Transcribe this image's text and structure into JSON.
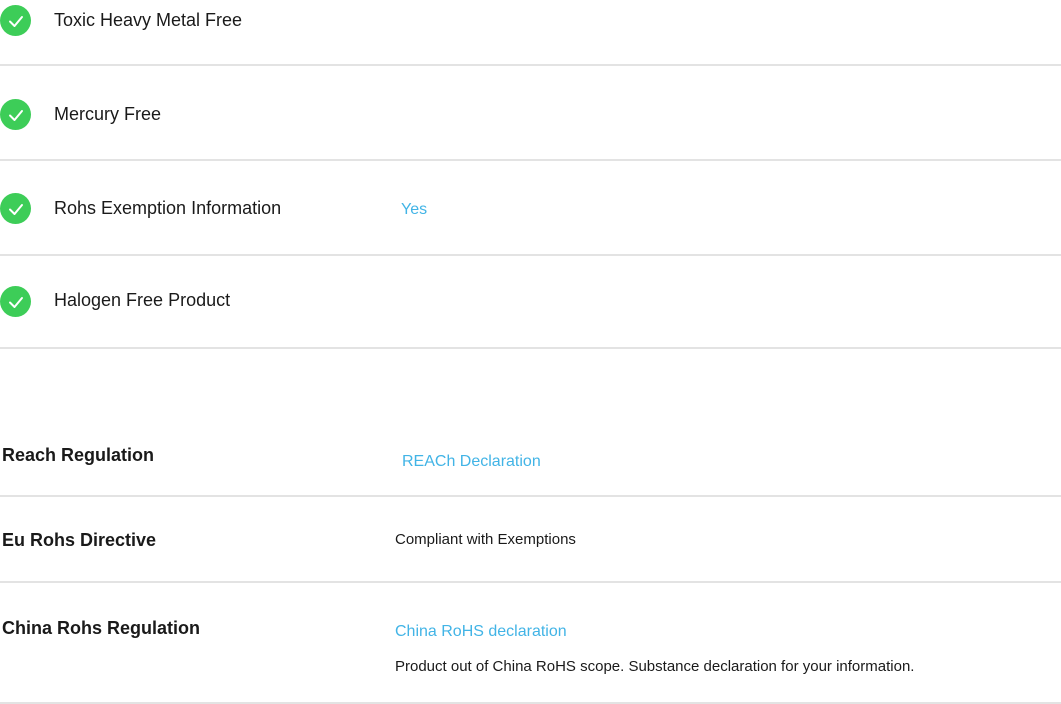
{
  "features": [
    {
      "label": "Toxic Heavy Metal Free",
      "icon": "check-circle-icon"
    },
    {
      "label": "Mercury Free",
      "icon": "check-circle-icon"
    },
    {
      "label": "Rohs Exemption Information",
      "value": "Yes",
      "icon": "check-circle-icon"
    },
    {
      "label": "Halogen Free Product",
      "icon": "check-circle-icon"
    }
  ],
  "regulations": {
    "reach": {
      "label": "Reach Regulation",
      "link": "REACh Declaration"
    },
    "eu_rohs": {
      "label": "Eu Rohs Directive",
      "value": "Compliant with Exemptions"
    },
    "china_rohs": {
      "label": "China Rohs Regulation",
      "link": "China RoHS declaration",
      "note": "Product out of China RoHS scope. Substance declaration for your information."
    }
  },
  "colors": {
    "accent": "#42b4e6",
    "check": "#3dcd58",
    "divider": "#e3e3e3"
  }
}
